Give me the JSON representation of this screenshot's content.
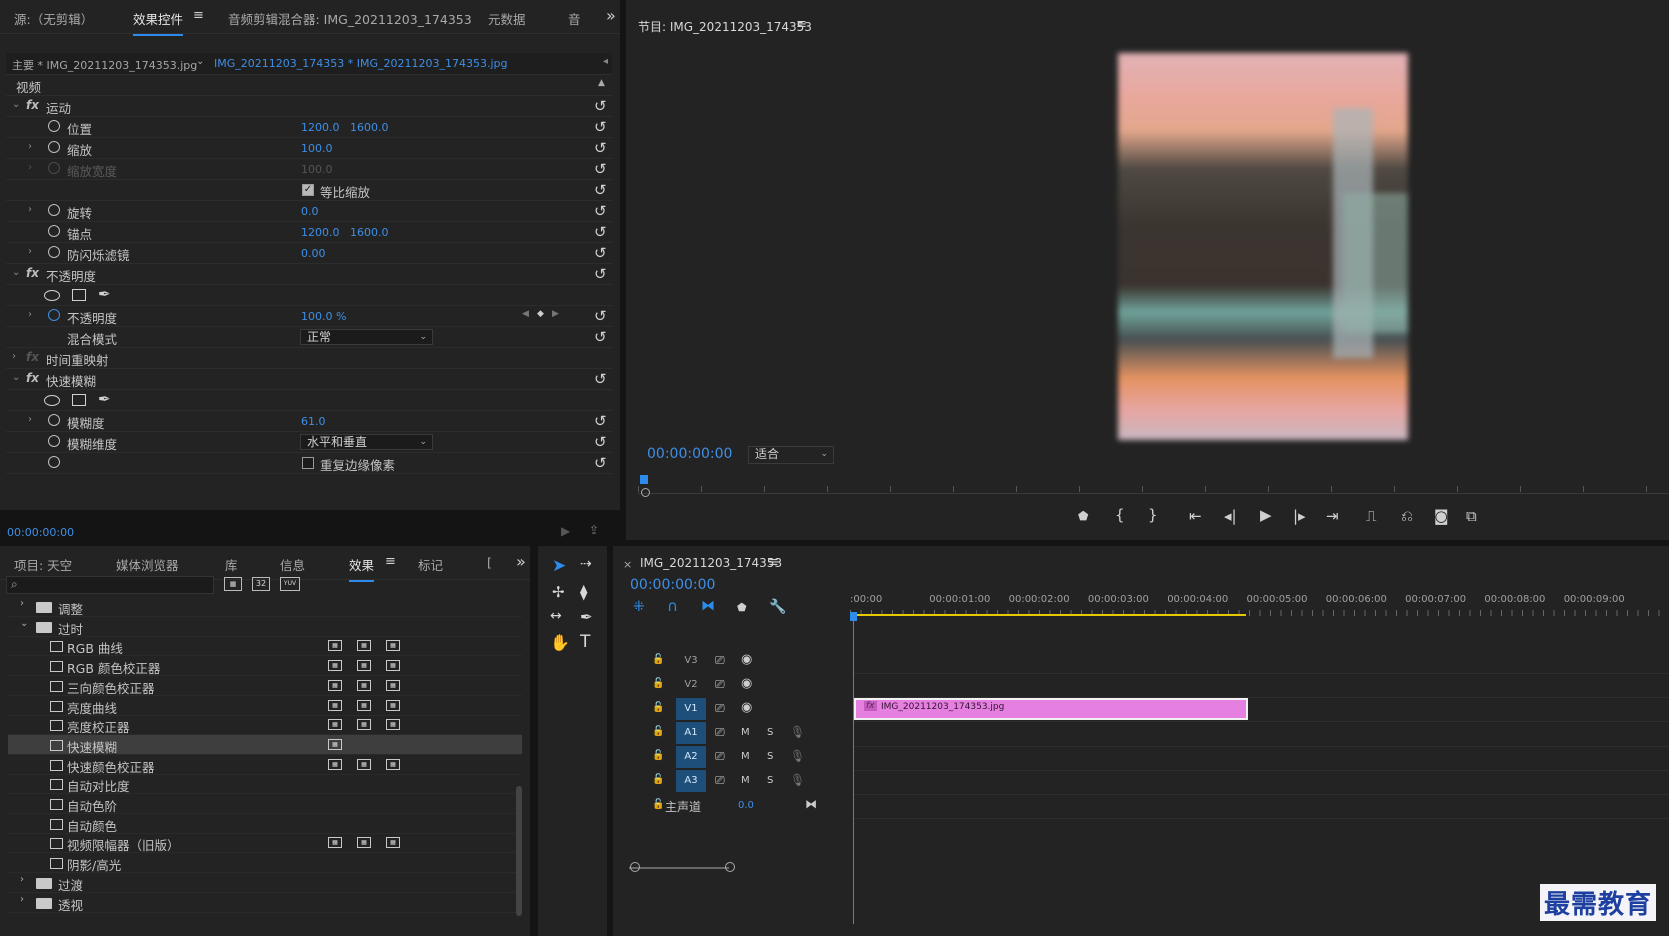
{
  "source_tab": "源:（无剪辑）",
  "effect_controls_tab": "效果控件",
  "audio_mixer_tab": "音频剪辑混合器: IMG_20211203_174353",
  "metadata_tab": "元数据",
  "audio_tab_cut": "音",
  "menu_icon": "≡",
  "more_icon": "»",
  "ec": {
    "master_label": "主要 * IMG_20211203_174353.jpg",
    "clip_label": "IMG_20211203_174353 * IMG_20211203_174353.jpg",
    "video_header": "视频",
    "motion": "运动",
    "position": "位置",
    "pos_x": "1200.0",
    "pos_y": "1600.0",
    "scale": "缩放",
    "scale_val": "100.0",
    "scale_width": "缩放宽度",
    "scale_width_val": "100.0",
    "uniform_scale": "等比缩放",
    "rotation": "旋转",
    "rotation_val": "0.0",
    "anchor": "锚点",
    "anchor_x": "1200.0",
    "anchor_y": "1600.0",
    "antiflicker": "防闪烁滤镜",
    "antiflicker_val": "0.00",
    "opacity_group": "不透明度",
    "opacity": "不透明度",
    "opacity_val": "100.0 %",
    "blend_mode": "混合模式",
    "blend_val": "正常",
    "time_remap": "时间重映射",
    "fast_blur": "快速模糊",
    "blurriness": "模糊度",
    "blurriness_val": "61.0",
    "blur_dimensions": "模糊维度",
    "blur_dim_val": "水平和垂直",
    "repeat_edge": "重复边缘像素",
    "timecode": "00:00:00:00"
  },
  "program": {
    "title": "节目: IMG_20211203_174353",
    "timecode": "00:00:00:00",
    "fit": "适合"
  },
  "project_tabs": {
    "project": "项目: 天空",
    "media": "媒体浏览器",
    "library": "库",
    "info": "信息",
    "effects": "效果",
    "markers": "标记",
    "cut": "[",
    "badges": [
      "32",
      "YUV"
    ]
  },
  "effects_list": [
    {
      "label": "调整",
      "type": "folder",
      "open": false,
      "badges": 0
    },
    {
      "label": "过时",
      "type": "folder",
      "open": true,
      "badges": 0
    },
    {
      "label": "RGB 曲线",
      "type": "fx",
      "badges": 3
    },
    {
      "label": "RGB 颜色校正器",
      "type": "fx",
      "badges": 3
    },
    {
      "label": "三向颜色校正器",
      "type": "fx",
      "badges": 3
    },
    {
      "label": "亮度曲线",
      "type": "fx",
      "badges": 3
    },
    {
      "label": "亮度校正器",
      "type": "fx",
      "badges": 3
    },
    {
      "label": "快速模糊",
      "type": "fx",
      "badges": 1,
      "selected": true
    },
    {
      "label": "快速颜色校正器",
      "type": "fx",
      "badges": 3
    },
    {
      "label": "自动对比度",
      "type": "fx",
      "badges": 0
    },
    {
      "label": "自动色阶",
      "type": "fx",
      "badges": 0
    },
    {
      "label": "自动颜色",
      "type": "fx",
      "badges": 0
    },
    {
      "label": "视频限幅器（旧版）",
      "type": "fx",
      "badges": 3
    },
    {
      "label": "阴影/高光",
      "type": "fx",
      "badges": 0
    },
    {
      "label": "过渡",
      "type": "folder",
      "open": false,
      "badges": 0
    },
    {
      "label": "透视",
      "type": "folder",
      "open": false,
      "badges": 0
    }
  ],
  "timeline": {
    "tab": "IMG_20211203_174353",
    "close": "×",
    "timecode": "00:00:00:00",
    "ruler": [
      ":00:00",
      "00:00:01:00",
      "00:00:02:00",
      "00:00:03:00",
      "00:00:04:00",
      "00:00:05:00",
      "00:00:06:00",
      "00:00:07:00",
      "00:00:08:00",
      "00:00:09:00"
    ],
    "tracks": [
      "V3",
      "V2",
      "V1",
      "A1",
      "A2",
      "A3"
    ],
    "mute": "M",
    "solo": "S",
    "master": "主声道",
    "master_val": "0.0",
    "clip_name": "IMG_20211203_174353.jpg",
    "clip_fx": "fx",
    "clip_color": "#e57fe0"
  },
  "watermark": "最需教育",
  "colors": {
    "accent": "#2d8ceb",
    "clip": "#e57fe0",
    "workarea": "#e6c700"
  }
}
